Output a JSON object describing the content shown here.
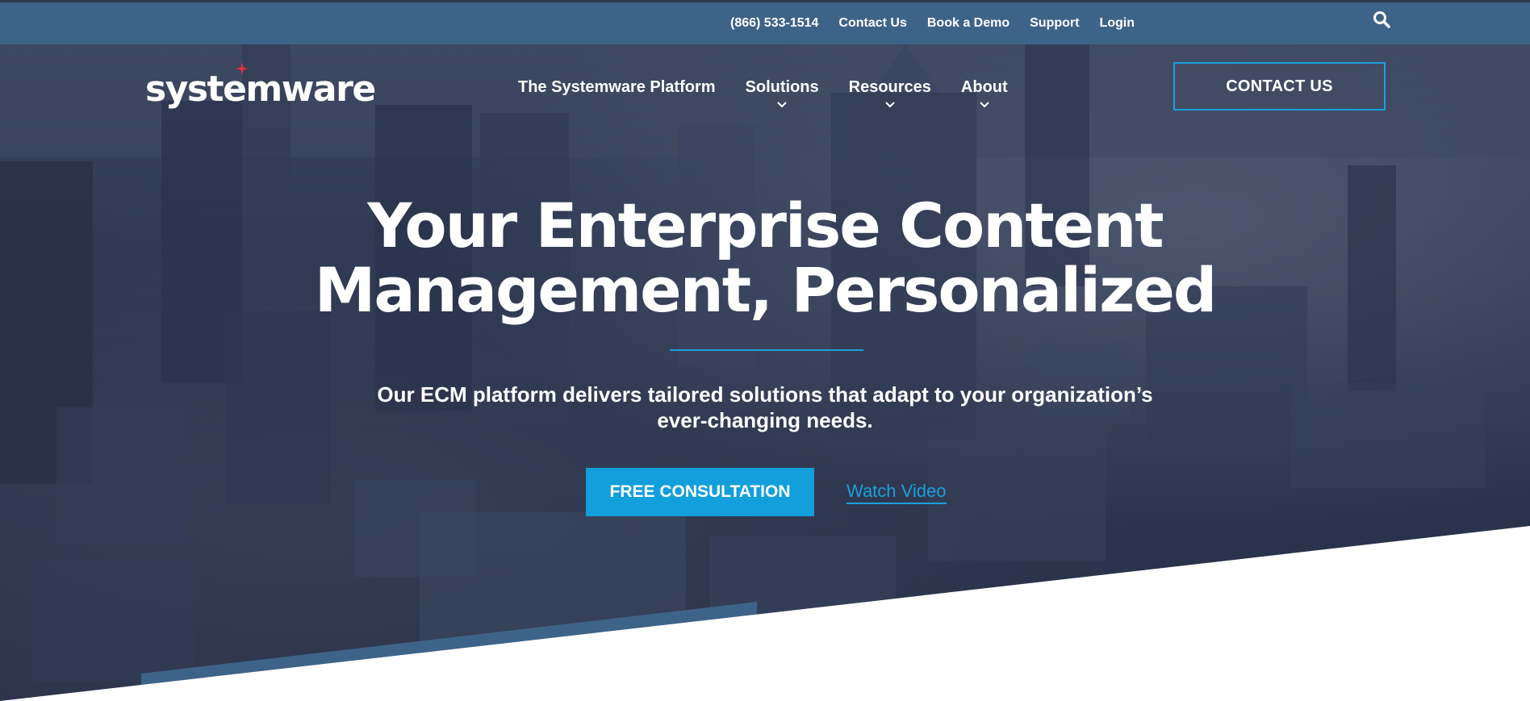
{
  "utility_bar": {
    "phone": "(866) 533-1514",
    "contact_us": "Contact Us",
    "book_demo": "Book a Demo",
    "support": "Support",
    "login": "Login",
    "search_icon": "search-icon"
  },
  "header": {
    "logo_text": "systemware",
    "nav": [
      {
        "label": "The Systemware Platform",
        "has_dropdown": false
      },
      {
        "label": "Solutions",
        "has_dropdown": true
      },
      {
        "label": "Resources",
        "has_dropdown": true
      },
      {
        "label": "About",
        "has_dropdown": true
      }
    ],
    "contact_button": "CONTACT US"
  },
  "hero": {
    "title_line1": "Your Enterprise Content",
    "title_line2": "Management, Personalized",
    "subtitle_line1": "Our ECM platform delivers tailored solutions that adapt to your organization’s",
    "subtitle_line2": "ever-changing needs.",
    "cta_button": "FREE CONSULTATION",
    "video_link": "Watch Video"
  },
  "colors": {
    "utility_bar": "#3e6388",
    "hero_overlay": "#2b344d",
    "accent_blue": "#129fdc",
    "logo_star": "#e8313f",
    "slant_panel": "#3e6388"
  }
}
